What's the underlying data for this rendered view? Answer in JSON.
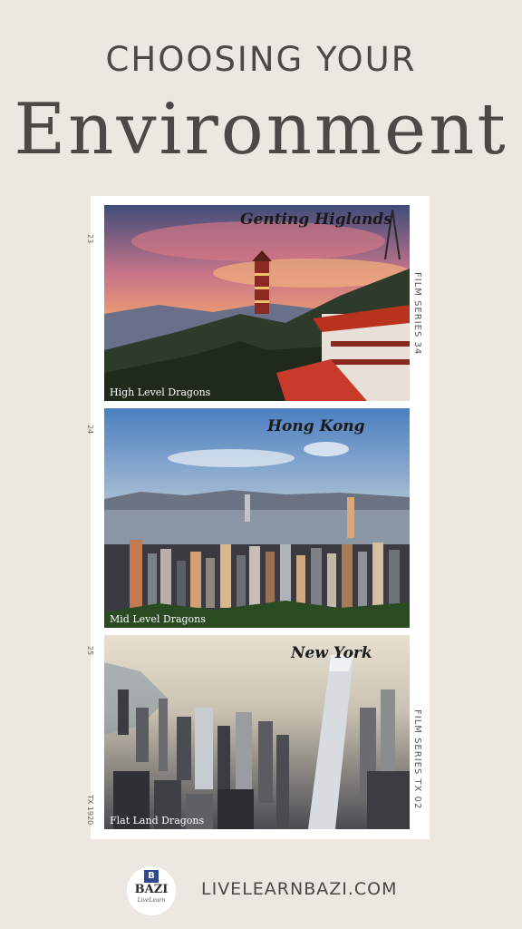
{
  "header": {
    "line1": "CHOOSING YOUR",
    "line2": "Environment"
  },
  "film": {
    "side_top": "FILM SERIES 34",
    "side_bottom": "FILM SERIES TX 02",
    "frame_numbers": [
      "23",
      "24",
      "25"
    ],
    "bottom_code": "TX 1920"
  },
  "photos": [
    {
      "title": "Genting Higlands",
      "caption": "High Level Dragons"
    },
    {
      "title": "Hong Kong",
      "caption": "Mid Level Dragons"
    },
    {
      "title": "New York",
      "caption": "Flat Land Dragons"
    }
  ],
  "footer": {
    "logo_badge": "B",
    "logo_name": "BAZI",
    "logo_sub": "LiveLearn",
    "url": "LIVELEARNBAZI.COM"
  },
  "colors": {
    "background": "#ede7e1",
    "text": "#4b4845",
    "frame": "#ffffff",
    "logo_blue": "#2f4a8a"
  }
}
